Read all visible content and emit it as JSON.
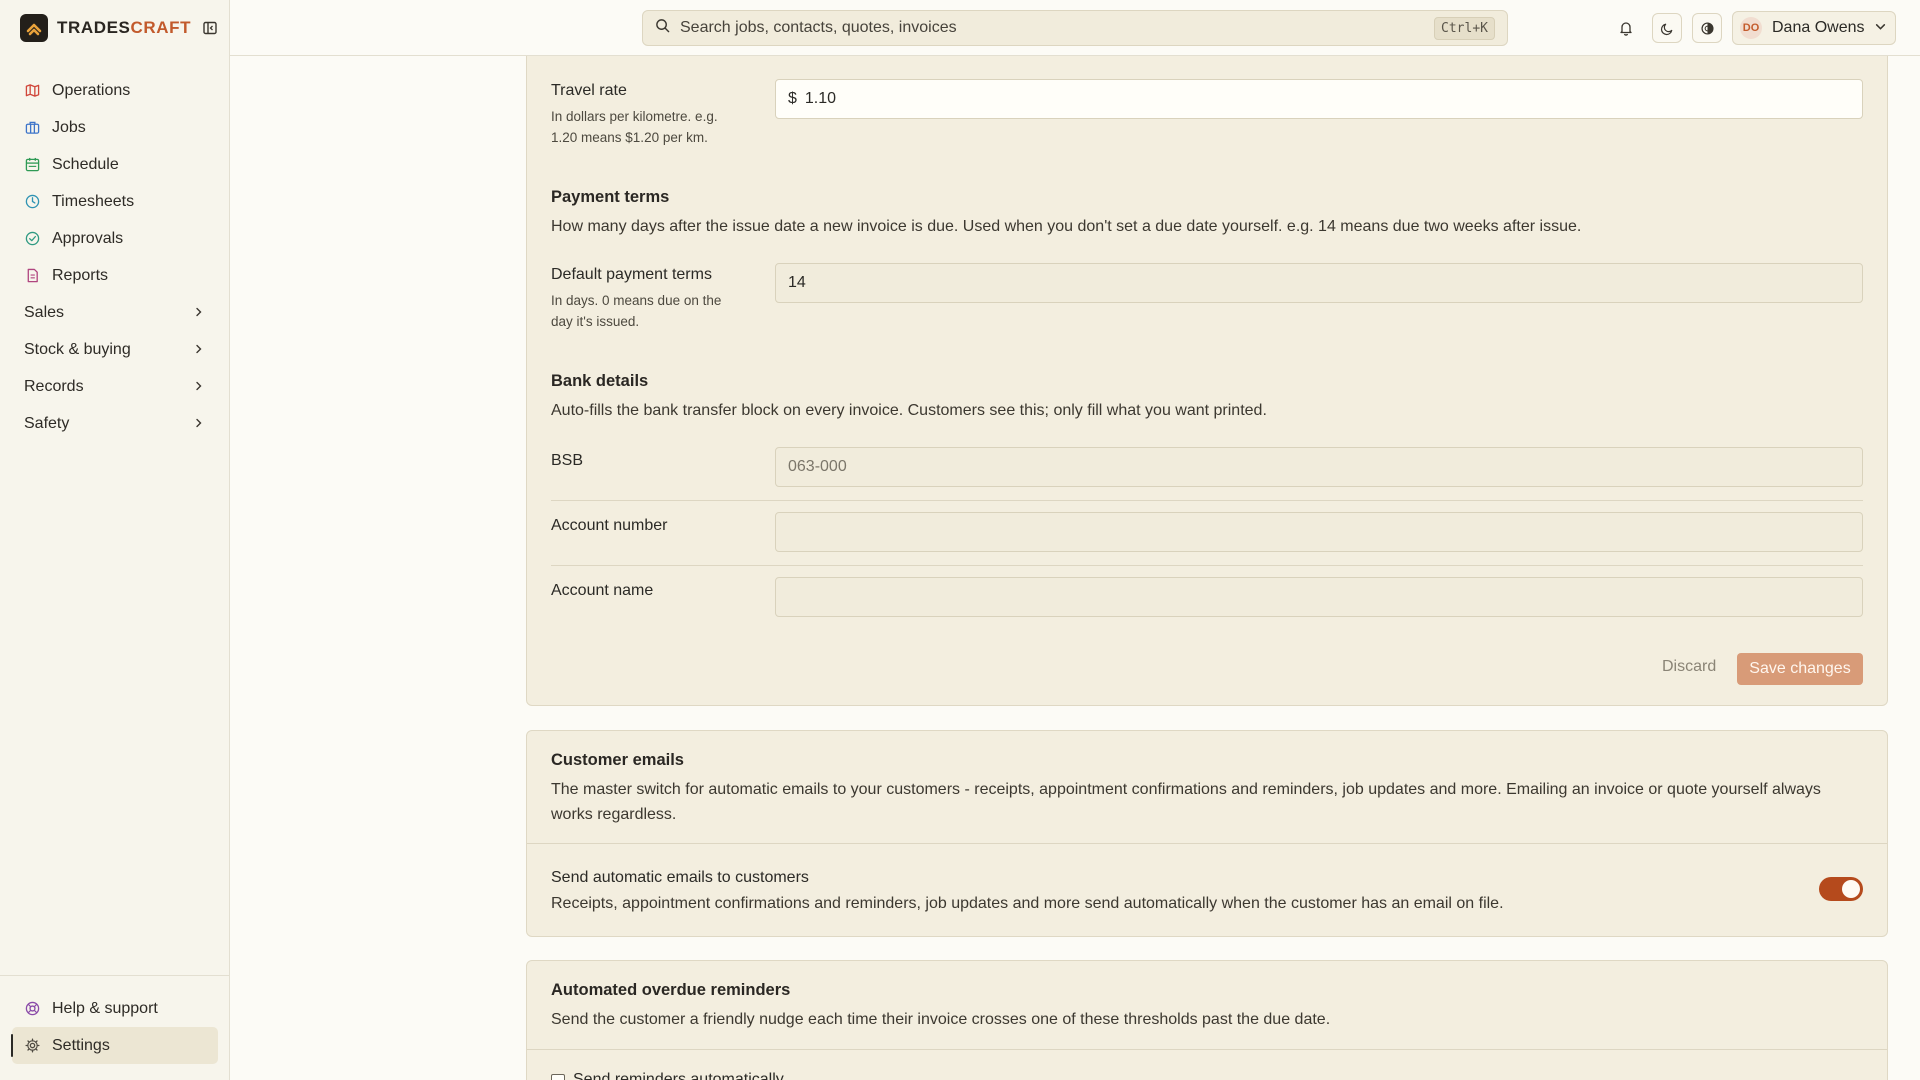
{
  "brand": {
    "name_a": "TRADES",
    "name_b": "CRAFT",
    "accent": "#c25a2c"
  },
  "sidebar": {
    "items": [
      {
        "label": "Operations",
        "icon": "map-icon",
        "color": "#d0463a"
      },
      {
        "label": "Jobs",
        "icon": "briefcase-icon",
        "color": "#3d74c9"
      },
      {
        "label": "Schedule",
        "icon": "calendar-icon",
        "color": "#2f9a55"
      },
      {
        "label": "Timesheets",
        "icon": "clock-icon",
        "color": "#2f93b3"
      },
      {
        "label": "Approvals",
        "icon": "check-circle-icon",
        "color": "#2f9a82"
      },
      {
        "label": "Reports",
        "icon": "document-icon",
        "color": "#b0457f"
      }
    ],
    "groups": [
      {
        "label": "Sales"
      },
      {
        "label": "Stock & buying"
      },
      {
        "label": "Records"
      },
      {
        "label": "Safety"
      }
    ],
    "bottom": [
      {
        "label": "Help & support",
        "icon": "lifebuoy-icon",
        "color": "#8a4aa8"
      },
      {
        "label": "Settings",
        "icon": "gear-icon",
        "color": "#4f4b42"
      }
    ]
  },
  "topbar": {
    "search_placeholder": "Search jobs, contacts, quotes, invoices",
    "search_shortcut": "Ctrl+K",
    "user_initials": "DO",
    "user_name": "Dana Owens"
  },
  "invoicing": {
    "travel_rate": {
      "label": "Travel rate",
      "hint": "In dollars per kilometre. e.g. 1.20 means $1.20 per km.",
      "prefix": "$",
      "value": "1.10"
    },
    "payment_terms": {
      "title": "Payment terms",
      "description": "How many days after the issue date a new invoice is due. Used when you don't set a due date yourself. e.g. 14 means due two weeks after issue.",
      "label": "Default payment terms",
      "hint": "In days. 0 means due on the day it's issued.",
      "value": "14"
    },
    "bank_details": {
      "title": "Bank details",
      "description": "Auto-fills the bank transfer block on every invoice. Customers see this; only fill what you want printed.",
      "bsb_label": "BSB",
      "bsb_placeholder": "063-000",
      "bsb_value": "",
      "account_number_label": "Account number",
      "account_number_value": "",
      "account_name_label": "Account name",
      "account_name_value": ""
    },
    "discard_label": "Discard",
    "save_label": "Save changes"
  },
  "customer_emails": {
    "title": "Customer emails",
    "description": "The master switch for automatic emails to your customers - receipts, appointment confirmations and reminders, job updates and more. Emailing an invoice or quote yourself always works regardless.",
    "toggle_label": "Send automatic emails to customers",
    "toggle_hint": "Receipts, appointment confirmations and reminders, job updates and more send automatically when the customer has an email on file.",
    "toggle_on": true
  },
  "overdue_reminders": {
    "title": "Automated overdue reminders",
    "description": "Send the customer a friendly nudge each time their invoice crosses one of these thresholds past the due date.",
    "checkbox_label": "Send reminders automatically"
  }
}
